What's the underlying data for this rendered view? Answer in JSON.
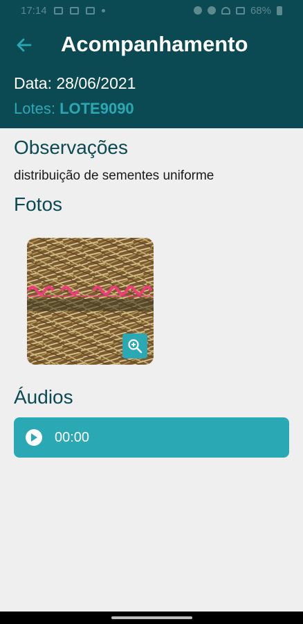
{
  "status_bar": {
    "time": "17:14",
    "battery": "68%"
  },
  "header": {
    "title": "Acompanhamento",
    "date_label": "Data: 28/06/2021",
    "lotes_label": "Lotes:",
    "lotes_value": "LOTE9090"
  },
  "observacoes": {
    "title": "Observações",
    "text": "distribuição de sementes uniforme"
  },
  "fotos": {
    "title": "Fotos"
  },
  "audios": {
    "title": "Áudios",
    "time": "00:00"
  },
  "colors": {
    "header_bg": "#0b4a52",
    "accent": "#2aa9b5",
    "page_bg": "#efefef"
  },
  "icons": {
    "back": "arrow-left-icon",
    "zoom": "zoom-in-icon",
    "play": "play-icon"
  }
}
